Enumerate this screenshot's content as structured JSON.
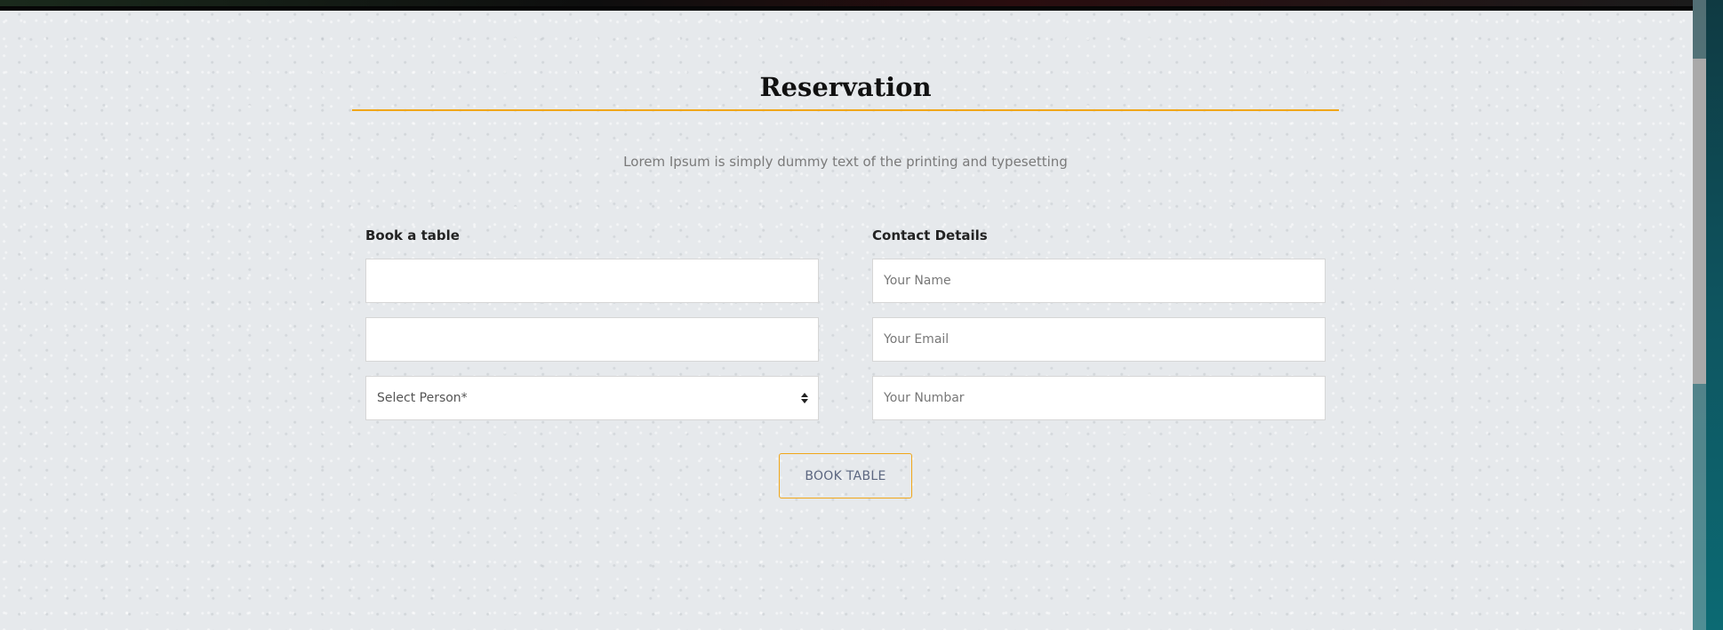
{
  "reservation": {
    "title": "Reservation",
    "subtitle": "Lorem Ipsum is simply dummy text of the printing and typesetting",
    "book_section": {
      "heading": "Book a table",
      "date_field": {
        "value": "",
        "placeholder": ""
      },
      "time_field": {
        "value": "",
        "placeholder": ""
      },
      "person_select": {
        "selected": "Select Person*"
      }
    },
    "contact_section": {
      "heading": "Contact Details",
      "name_field": {
        "placeholder": "Your Name"
      },
      "email_field": {
        "placeholder": "Your Email"
      },
      "number_field": {
        "placeholder": "Your Numbar"
      }
    },
    "submit_label": "BOOK TABLE"
  },
  "colors": {
    "accent": "#f0a619",
    "background": "#e6e9ec",
    "button_text": "#5b6680"
  },
  "icons": {
    "select_arrow": "sort-updown-icon"
  }
}
